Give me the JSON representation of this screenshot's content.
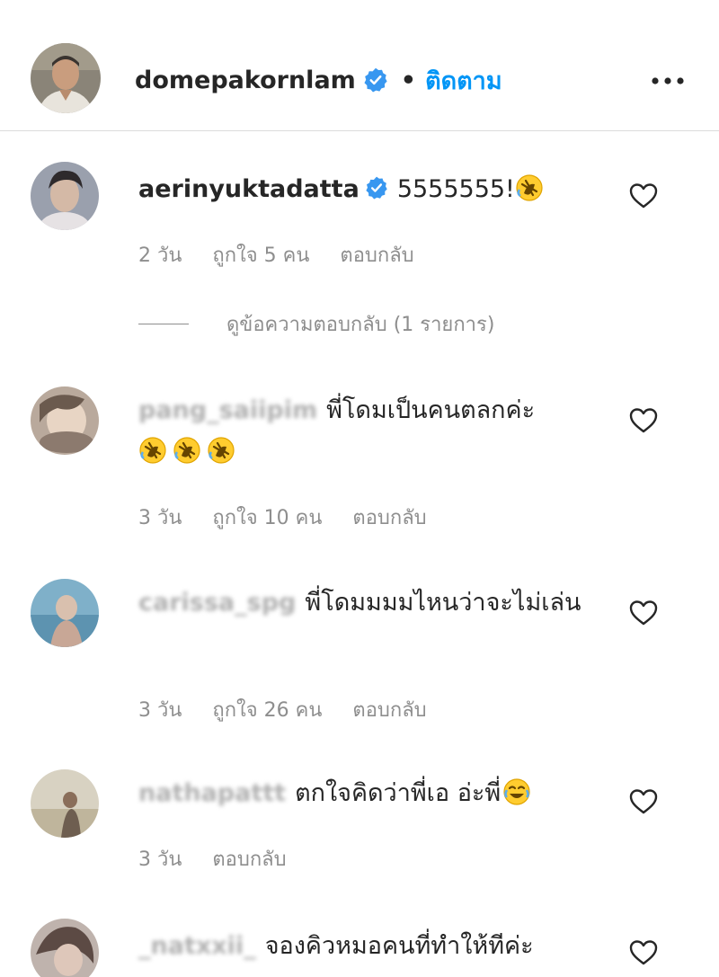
{
  "header": {
    "owner_username": "domepakornlam",
    "separator": "•",
    "follow_label": "ติดตาม",
    "more_glyph": "•••"
  },
  "comments": [
    {
      "username": "aerinyuktadatta",
      "verified": true,
      "text": "5555555!",
      "emoji": [
        "rofl"
      ],
      "time": "2 วัน",
      "likes": "ถูกใจ 5 คน",
      "reply": "ตอบกลับ",
      "view_replies": "ดูข้อความตอบกลับ (1 รายการ)"
    },
    {
      "username": "pang_saiipim",
      "text": "พี่โดมเป็นคนตลกค่ะ",
      "emoji": [
        "rofl",
        "rofl",
        "rofl"
      ],
      "time": "3 วัน",
      "likes": "ถูกใจ 10 คน",
      "reply": "ตอบกลับ"
    },
    {
      "username": "carissa_spg",
      "text": "พี่โดมมมมไหนว่าจะไม่เล่น",
      "time": "3 วัน",
      "likes": "ถูกใจ 26 คน",
      "reply": "ตอบกลับ"
    },
    {
      "username": "nathapattt",
      "text": "ตกใจคิดว่าพี่เอ อ่ะพี่",
      "emoji": [
        "joy"
      ],
      "time": "3 วัน",
      "reply": "ตอบกลับ"
    },
    {
      "username": "_natxxii_",
      "text": "จองคิวหมอคนที่ทำให้ทีค่ะ"
    }
  ],
  "icons": {
    "verified": "verified-badge-icon",
    "like": "heart-outline-icon",
    "more": "more-options-icon",
    "rofl": "rolling-on-floor-laughing-emoji",
    "joy": "face-with-tears-of-joy-emoji"
  },
  "colors": {
    "link_blue": "#0095f6",
    "verified_blue": "#3897f0",
    "meta_gray": "#8e8e8e",
    "divider": "#dbdbdb",
    "text": "#262626"
  }
}
